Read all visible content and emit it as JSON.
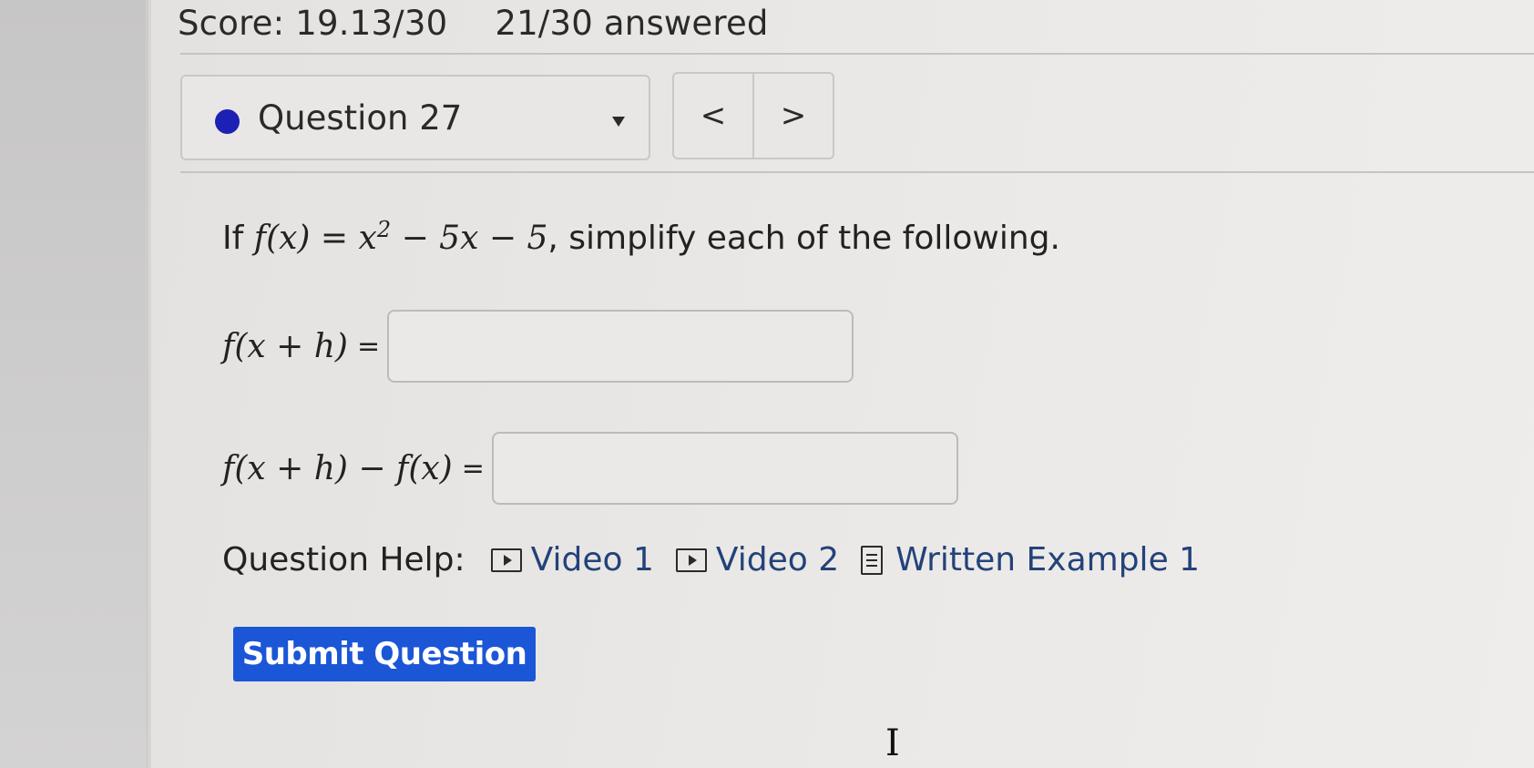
{
  "header": {
    "score": "Score: 19.13/30",
    "answered": "21/30 answered"
  },
  "question_nav": {
    "current": "Question 27",
    "status_color": "#1d20b5",
    "prev_label": "<",
    "next_label": ">"
  },
  "question": {
    "prefix": "If",
    "function_def": "f(x) = x² − 5x − 5",
    "suffix": ", simplify each of the following."
  },
  "answers": [
    {
      "expression": "f(x + h)",
      "equals": "=",
      "value": ""
    },
    {
      "expression": "f(x + h) − f(x)",
      "equals": "=",
      "value": ""
    }
  ],
  "help": {
    "label": "Question Help:",
    "links": [
      {
        "label": "Video 1",
        "icon": "video-icon"
      },
      {
        "label": "Video 2",
        "icon": "video-icon"
      },
      {
        "label": "Written Example 1",
        "icon": "document-icon"
      }
    ]
  },
  "submit": {
    "label": "Submit Question",
    "color": "#1b56d6"
  },
  "cursor": {
    "icon": "text-cursor-icon"
  }
}
